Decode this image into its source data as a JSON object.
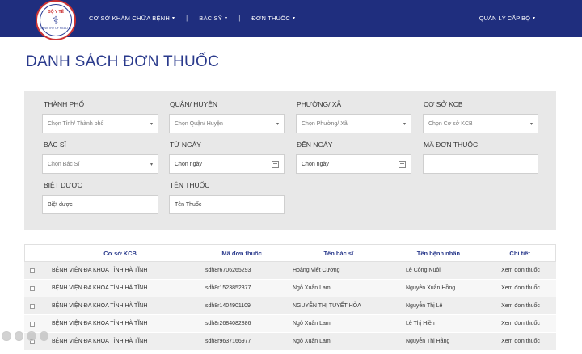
{
  "header": {
    "logo": {
      "top_text": "BỘ Y TẾ",
      "bottom_text": "MINISTRY OF HEALTH",
      "icon": "caduceus-icon"
    },
    "nav": [
      {
        "label": "CƠ SỞ KHÁM CHỮA BỆNH"
      },
      {
        "label": "BÁC SỸ"
      },
      {
        "label": "ĐƠN THUỐC"
      }
    ],
    "right_menu": {
      "label": "QUẢN LÝ CẤP BỘ"
    }
  },
  "page": {
    "title": "DANH SÁCH ĐƠN THUỐC"
  },
  "filters": {
    "city": {
      "label": "THÀNH PHỐ",
      "placeholder": "Chọn Tỉnh/ Thành phố"
    },
    "district": {
      "label": "QUẬN/ HUYỆN",
      "placeholder": "Chọn Quận/ Huyện"
    },
    "ward": {
      "label": "PHƯỜNG/ XÃ",
      "placeholder": "Chọn Phường/ Xã"
    },
    "facility": {
      "label": "CƠ SỞ KCB",
      "placeholder": "Chọn Cơ sở KCB"
    },
    "doctor": {
      "label": "BÁC SĨ",
      "placeholder": "Chọn Bác Sĩ"
    },
    "from_date": {
      "label": "TỪ NGÀY",
      "placeholder": "Chọn ngày"
    },
    "to_date": {
      "label": "ĐẾN NGÀY",
      "placeholder": "Chọn ngày"
    },
    "code": {
      "label": "MÃ ĐƠN THUỐC",
      "placeholder": ""
    },
    "brand": {
      "label": "BIỆT DƯỢC",
      "placeholder": "Biệt dược"
    },
    "drug": {
      "label": "TÊN THUỐC",
      "placeholder": "Tên Thuốc"
    }
  },
  "table": {
    "headers": {
      "facility": "Cơ sở KCB",
      "code": "Mã đơn thuốc",
      "doctor": "Tên bác sĩ",
      "patient": "Tên bệnh nhân",
      "detail": "Chi tiết"
    },
    "rows": [
      {
        "facility": "BỆNH VIỆN ĐA KHOA TỈNH HÀ TĨNH",
        "code": "sdh8r6706265293",
        "doctor": "Hoàng Viết Cường",
        "patient": "Lê Công Nuôi",
        "detail": "Xem đơn thuốc"
      },
      {
        "facility": "BỆNH VIỆN ĐA KHOA TỈNH HÀ TĨNH",
        "code": "sdh8r1523852377",
        "doctor": "Ngô Xuân Lam",
        "patient": "Nguyễn Xuân Hồng",
        "detail": "Xem đơn thuốc"
      },
      {
        "facility": "BỆNH VIỆN ĐA KHOA TỈNH HÀ TĨNH",
        "code": "sdh8r1404901109",
        "doctor": "NGUYỄN THỊ TUYẾT HÒA",
        "patient": "Nguyễn Thị Lê",
        "detail": "Xem đơn thuốc"
      },
      {
        "facility": "BỆNH VIỆN ĐA KHOA TỈNH HÀ TĨNH",
        "code": "sdh8r2684082886",
        "doctor": "Ngô Xuân Lam",
        "patient": "Lê Thị Hiền",
        "detail": "Xem đơn thuốc"
      },
      {
        "facility": "BỆNH VIỆN ĐA KHOA TỈNH HÀ TĨNH",
        "code": "sdh8r9637166977",
        "doctor": "Ngô Xuân Lam",
        "patient": "Nguyễn Thị Hằng",
        "detail": "Xem đơn thuốc"
      }
    ]
  },
  "colors": {
    "header_bg": "#1f2e7e",
    "title": "#2a3a8c",
    "panel_bg": "#e8e8e8"
  }
}
